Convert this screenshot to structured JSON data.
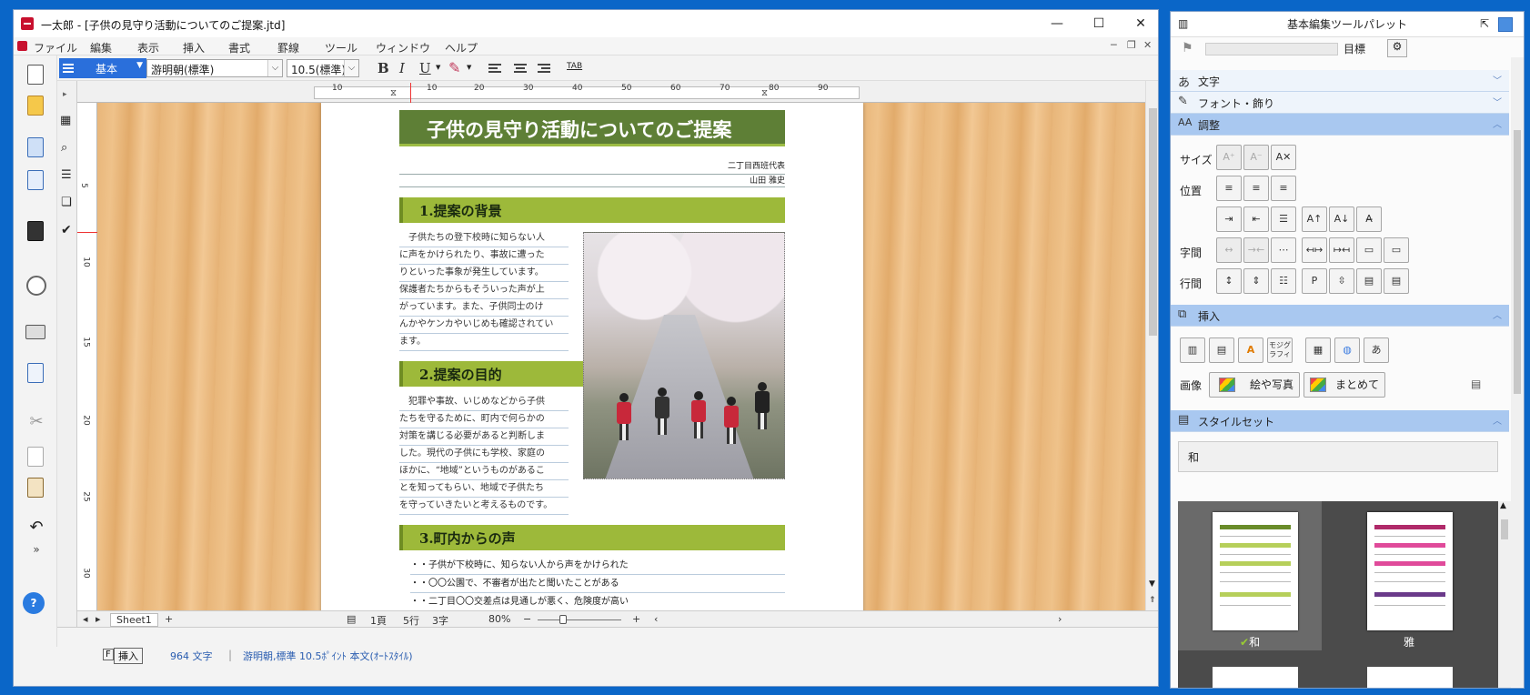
{
  "window": {
    "title": "一太郎 - [子供の見守り活動についてのご提案.jtd]",
    "minimize": "—",
    "maximize": "☐",
    "close": "✕"
  },
  "menu": [
    "ファイル",
    "編集",
    "表示",
    "挿入",
    "書式",
    "罫線",
    "ツール",
    "ウィンドウ",
    "ヘルプ"
  ],
  "toolbar": {
    "style": "基本",
    "font": "游明朝(標準)",
    "size": "10.5(標準)",
    "bold": "B",
    "italic": "I",
    "underline": "U",
    "tab": "TAB"
  },
  "ruler": {
    "h_numbers": [
      "10",
      "10",
      "20",
      "30",
      "40",
      "50",
      "60",
      "70",
      "80",
      "90"
    ],
    "v_numbers": [
      "5",
      "10",
      "15",
      "20",
      "25",
      "30"
    ]
  },
  "document": {
    "title": "子供の見守り活動についてのご提案",
    "meta1": "二丁目西班代表",
    "meta2": "山田 雅史",
    "sec1": "1.提案の背景",
    "sec1_lines": [
      "　子供たちの登下校時に知らない人",
      "に声をかけられたり、事故に遭った",
      "りといった事象が発生しています。",
      "保護者たちからもそういった声が上",
      "がっています。また、子供同士のけ",
      "んかやケンカやいじめも確認されてい",
      "ます。"
    ],
    "sec2": "2.提案の目的",
    "sec2_lines": [
      "　犯罪や事故、いじめなどから子供",
      "たちを守るために、町内で何らかの",
      "対策を講じる必要があると判断しま",
      "した。現代の子供にも学校、家庭の",
      "ほかに、“地域”というものがあるこ",
      "とを知ってもらい、地域で子供たち",
      "を守っていきたいと考えるものです。"
    ],
    "sec3": "3.町内からの声",
    "sec3_items": [
      "・・子供が下校時に、知らない人から声をかけられた",
      "・・〇〇公園で、不審者が出たと聞いたことがある",
      "・・二丁目〇〇交差点は見通しが悪く、危険度が高い"
    ]
  },
  "sheetbar": {
    "tab": "Sheet1",
    "add": "+",
    "page": "1頁",
    "line": "5行",
    "col": "3字",
    "zoom": "80%"
  },
  "status": {
    "mode_key": "F",
    "mode": "挿入",
    "chars": "964 文字",
    "font_info": "游明朝,標準  10.5ﾎﾟｲﾝﾄ  本文(ｵｰﾄｽﾀｲﾙ)"
  },
  "palette": {
    "title": "基本編集ツールパレット",
    "goal_label": "目標",
    "sections": {
      "text": "文字",
      "font": "フォント・飾り",
      "adjust": "調整",
      "insert": "挿入",
      "styleset": "スタイルセット"
    },
    "labels": {
      "size": "サイズ",
      "position": "位置",
      "spacing": "字間",
      "linespacing": "行間",
      "image": "画像"
    },
    "image_buttons": [
      "絵や写真",
      "まとめて"
    ],
    "styleset_current": "和",
    "styles": [
      "和",
      "雅"
    ],
    "moji_graphy": "モジグラフィ"
  }
}
